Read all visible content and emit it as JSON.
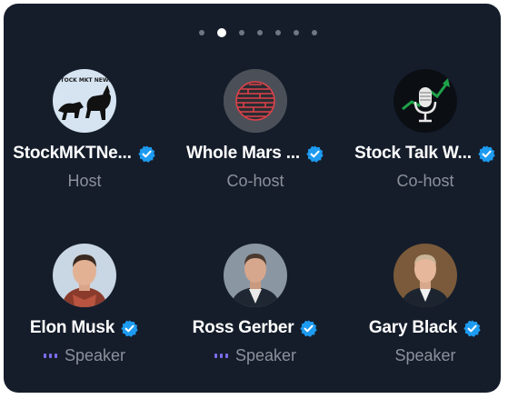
{
  "pager": {
    "page_count": 7,
    "active_index": 1
  },
  "colors": {
    "panel_bg": "#151d2b",
    "verified_badge": "#1d9bf0",
    "speaking_indicator": "#7d6cf0",
    "role_text": "#8b919a"
  },
  "members": [
    {
      "name": "StockMKTNe...",
      "role": "Host",
      "verified": true,
      "speaking": false,
      "avatar_text": "STOCK MKT NEWS",
      "avatar_icon": "bull-bear-logo-icon"
    },
    {
      "name": "Whole Mars ...",
      "role": "Co-host",
      "verified": true,
      "speaking": false,
      "avatar_icon": "red-globe-logo-icon"
    },
    {
      "name": "Stock Talk W...",
      "role": "Co-host",
      "verified": true,
      "speaking": false,
      "avatar_icon": "microphone-chart-logo-icon"
    },
    {
      "name": "Elon Musk",
      "role": "Speaker",
      "verified": true,
      "speaking": true,
      "avatar_icon": "person-photo-icon"
    },
    {
      "name": "Ross Gerber",
      "role": "Speaker",
      "verified": true,
      "speaking": true,
      "avatar_icon": "person-photo-icon"
    },
    {
      "name": "Gary Black",
      "role": "Speaker",
      "verified": true,
      "speaking": false,
      "avatar_icon": "person-photo-icon"
    }
  ]
}
